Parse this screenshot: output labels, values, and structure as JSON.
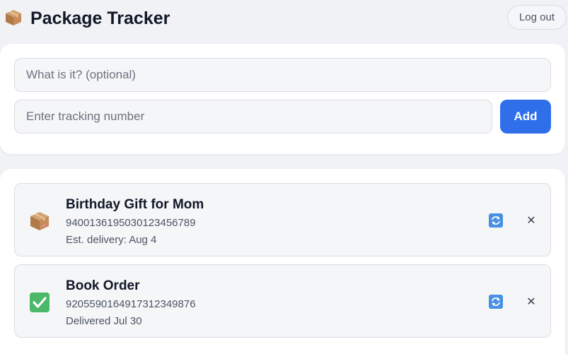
{
  "app": {
    "title": "Package Tracker",
    "logo_icon": "package-box-icon",
    "logout_label": "Log out"
  },
  "form": {
    "description_placeholder": "What is it? (optional)",
    "description_value": "",
    "tracking_placeholder": "Enter tracking number",
    "tracking_value": "",
    "add_label": "Add"
  },
  "colors": {
    "accent": "#2f6fea",
    "background": "#f1f2f6",
    "card": "#ffffff"
  },
  "packages": [
    {
      "name": "Birthday Gift for Mom",
      "tracking_number": "9400136195030123456789",
      "status_text": "Est. delivery: Aug 4",
      "status_icon": "package-box-icon",
      "refresh_icon": "refresh-icon",
      "remove_icon": "close-icon",
      "remove_glyph": "✕"
    },
    {
      "name": "Book Order",
      "tracking_number": "9205590164917312349876",
      "status_text": "Delivered Jul 30",
      "status_icon": "check-mark-icon",
      "refresh_icon": "refresh-icon",
      "remove_icon": "close-icon",
      "remove_glyph": "✕"
    }
  ]
}
